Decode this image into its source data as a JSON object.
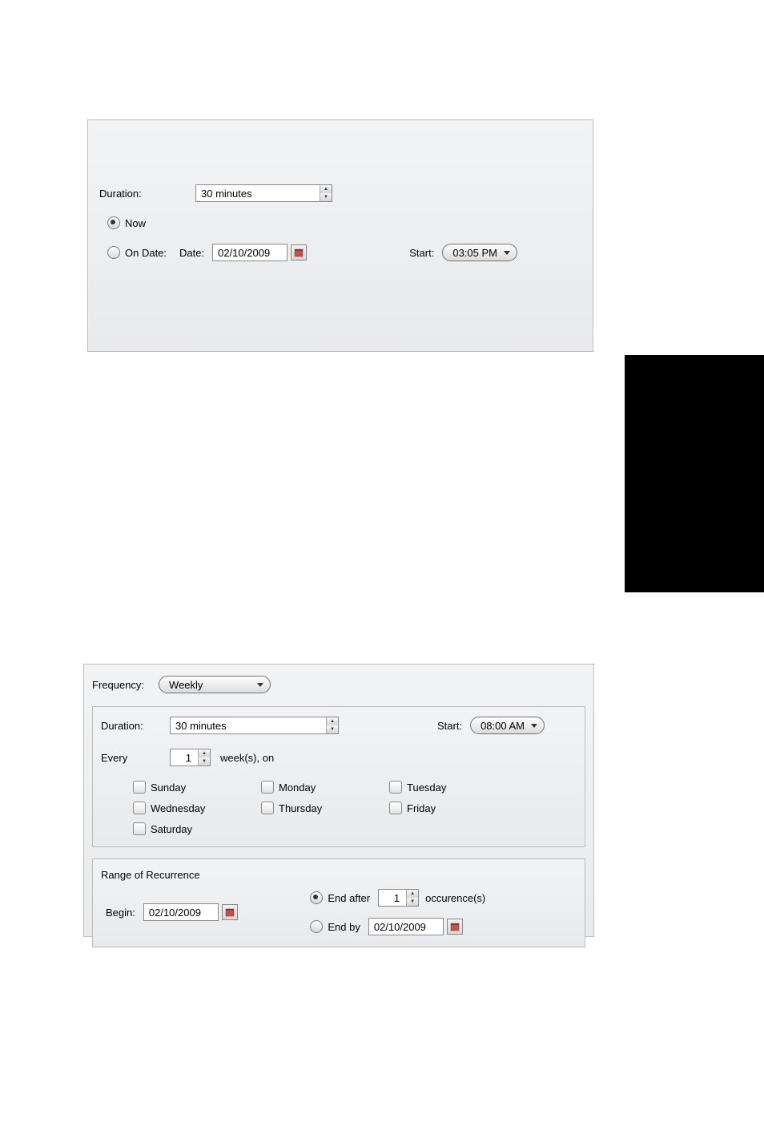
{
  "panel1": {
    "duration_label": "Duration:",
    "duration_value": "30 minutes",
    "now_label": "Now",
    "on_date_label": "On Date:",
    "date_label": "Date:",
    "date_value": "02/10/2009",
    "start_label": "Start:",
    "start_value": "03:05 PM"
  },
  "panel2": {
    "frequency_label": "Frequency:",
    "frequency_value": "Weekly",
    "duration_label": "Duration:",
    "duration_value": "30 minutes",
    "start_label": "Start:",
    "start_value": "08:00 AM",
    "every_label": "Every",
    "every_value": "1",
    "weeks_on_label": "week(s), on",
    "days": [
      "Sunday",
      "Monday",
      "Tuesday",
      "Wednesday",
      "Thursday",
      "Friday",
      "Saturday"
    ],
    "range_title": "Range of Recurrence",
    "begin_label": "Begin:",
    "begin_value": "02/10/2009",
    "end_after_label": "End after",
    "end_after_value": "1",
    "occurrences_label": "occurence(s)",
    "end_by_label": "End by",
    "end_by_value": "02/10/2009"
  }
}
